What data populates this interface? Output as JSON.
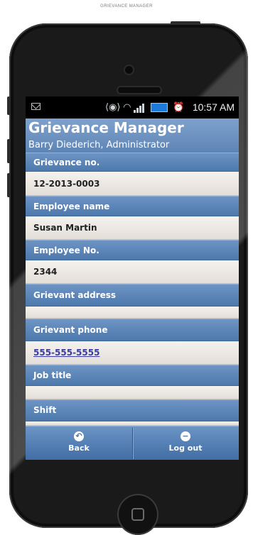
{
  "caption": "GRIEVANCE MANAGER",
  "status_bar": {
    "time": "10:57 AM",
    "icons": [
      "mail-icon",
      "vibrate-icon",
      "wifi-icon",
      "signal-icon",
      "battery-icon",
      "alarm-icon"
    ]
  },
  "header": {
    "title": "Grievance Manager",
    "subtitle": "Barry Diederich, Administrator"
  },
  "fields": [
    {
      "label": "Grievance no.",
      "value": "12-2013-0003"
    },
    {
      "label": "Employee name",
      "value": "Susan Martin"
    },
    {
      "label": "Employee No.",
      "value": "2344"
    },
    {
      "label": "Grievant address",
      "value": ""
    },
    {
      "label": "Grievant phone",
      "value": "555-555-5555"
    },
    {
      "label": "Job title",
      "value": ""
    },
    {
      "label": "Shift",
      "value": ""
    }
  ],
  "footer": {
    "back_label": "Back",
    "logout_label": "Log out"
  },
  "colors": {
    "header_blue": "#6d94c4",
    "value_background": "#efebe6",
    "link": "#3a3aa8"
  }
}
